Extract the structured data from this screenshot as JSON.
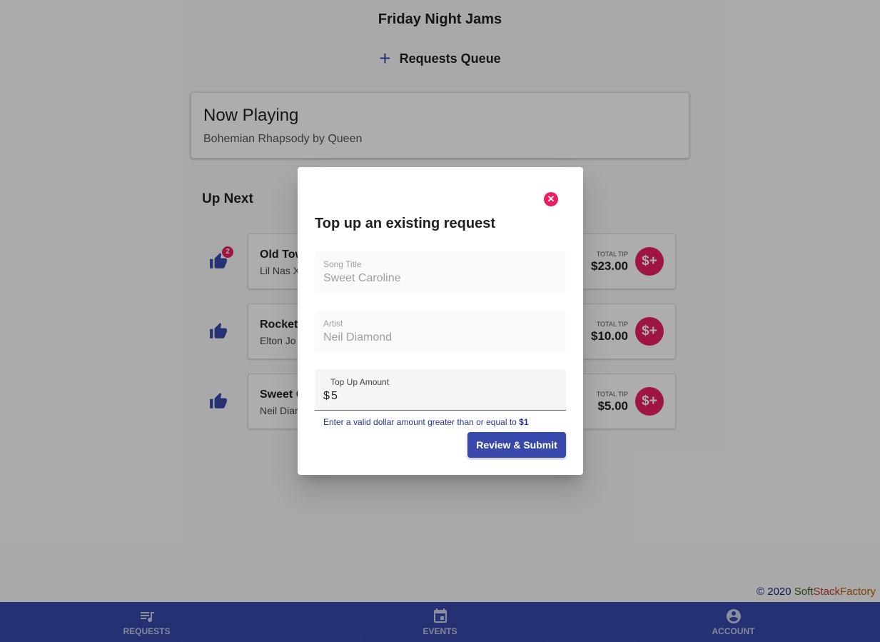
{
  "app": {
    "title": "Friday Night Jams"
  },
  "queue": {
    "title": "Requests Queue",
    "add_icon": "plus-icon"
  },
  "now_playing": {
    "heading": "Now Playing",
    "song": "Bohemian Rhapsody by Queen"
  },
  "up_next": {
    "heading": "Up Next",
    "tip_label": "TOTAL TIP",
    "items": [
      {
        "song": "Old Tow",
        "artist": "Lil Nas X",
        "votes": "2",
        "tip": "$23.00"
      },
      {
        "song": "Rocket",
        "artist": "Elton Jo",
        "votes": "",
        "tip": "$10.00"
      },
      {
        "song": "Sweet C",
        "artist": "Neil Diar",
        "votes": "",
        "tip": "$5.00"
      }
    ],
    "tip_button_label": "$+"
  },
  "footer": {
    "copyright_prefix": "© 2020 ",
    "brand_soft": "Soft",
    "brand_stack": "Stack",
    "brand_factory": "Factory"
  },
  "bottom_nav": {
    "items": [
      {
        "label": "REQUESTS",
        "icon": "queue-music-icon"
      },
      {
        "label": "EVENTS",
        "icon": "calendar-icon"
      },
      {
        "label": "ACCOUNT",
        "icon": "account-circle-icon"
      }
    ]
  },
  "dialog": {
    "title": "Top up an existing request",
    "close_icon": "close-icon",
    "song_field": {
      "label": "Song Title",
      "value": "Sweet Caroline"
    },
    "artist_field": {
      "label": "Artist",
      "value": "Neil Diamond"
    },
    "amount_field": {
      "label": "Top Up Amount",
      "prefix": "$",
      "value": "5"
    },
    "hint_text": "Enter a valid dollar amount greater than or equal to ",
    "hint_min": "$1",
    "submit_label": "Review & Submit"
  },
  "colors": {
    "primary": "#3949ab",
    "accent": "#e91e63"
  }
}
